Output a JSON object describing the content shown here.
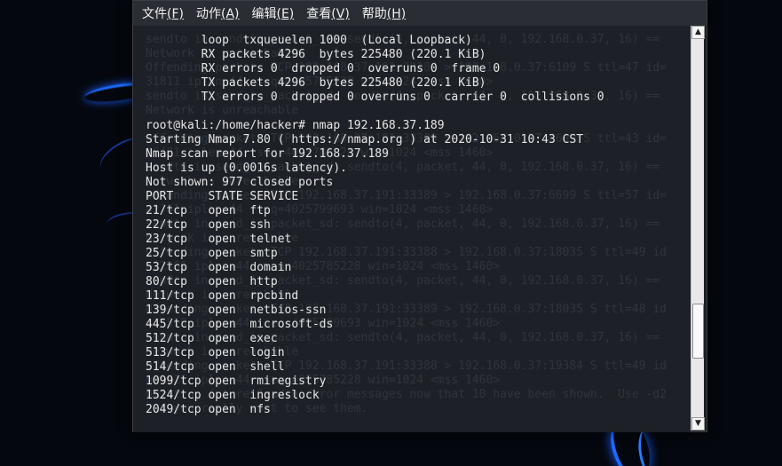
{
  "menu": {
    "items": [
      {
        "label": "文件",
        "accel": "(F)"
      },
      {
        "label": "动作",
        "accel": "(A)"
      },
      {
        "label": "编辑",
        "accel": "(E)"
      },
      {
        "label": "查看",
        "accel": "(V)"
      },
      {
        "label": "帮助",
        "accel": "(H)"
      }
    ]
  },
  "terminal": {
    "lines": [
      "        loop  txqueuelen 1000  (Local Loopback)",
      "        RX packets 4296  bytes 225480 (220.1 KiB)",
      "        RX errors 0  dropped 0  overruns 0  frame 0",
      "        TX packets 4296  bytes 225480 (220.1 KiB)",
      "        TX errors 0  dropped 0 overruns 0  carrier 0  collisions 0",
      "",
      "root@kali:/home/hacker# nmap 192.168.37.189",
      "Starting Nmap 7.80 ( https://nmap.org ) at 2020-10-31 10:43 CST",
      "Nmap scan report for 192.168.37.189",
      "Host is up (0.0016s latency).",
      "Not shown: 977 closed ports",
      "PORT     STATE SERVICE",
      "21/tcp   open  ftp",
      "22/tcp   open  ssh",
      "23/tcp   open  telnet",
      "25/tcp   open  smtp",
      "53/tcp   open  domain",
      "80/tcp   open  http",
      "111/tcp  open  rpcbind",
      "139/tcp  open  netbios-ssn",
      "445/tcp  open  microsoft-ds",
      "512/tcp  open  exec",
      "513/tcp  open  login",
      "514/tcp  open  shell",
      "1099/tcp open  rmiregistry",
      "1524/tcp open  ingreslock",
      "2049/tcp open  nfs"
    ],
    "ghost_lines": [
      "sendto in send_ip_packet_sd: sendto(4, packet, 44, 0, 192.168.0.37, 16) ==",
      "Network is unreachable",
      "Offending packet: TCP 192.168.37.191:33388 > 192.168.0.37:6109 S ttl=47 id=",
      "31811 iplen=44  seq=4025785228 win=1024 <mss 1460>",
      "sendto in send_ip_packet_sd: sendto(4, packet, 44, 0, 192.168.0.37, 16) ==",
      "Network is unreachable",
      "",
      "Offending packet: TCP 192.168.37.191:33389 > 192.168.0.37:6699 S ttl=43 id=",
      "26421 iplen=44  seq=4025785228 win=1024 <mss 1460>",
      "sendto in send_ip_packet_sd: sendto(4, packet, 44, 0, 192.168.0.37, 16) ==",
      "Network is unreachable",
      "Offending packet: TCP 192.168.37.191:33389 > 192.168.0.37:6699 S ttl=57 id=",
      "42761 iplen=44  seq=4025799693 win=1024 <mss 1460>",
      "sendto in send_ip_packet_sd: sendto(4, packet, 44, 0, 192.168.0.37, 16) ==",
      "Network is unreachable",
      "Offending packet: TCP 192.168.37.191:33388 > 192.168.0.37:18035 S ttl=49 id",
      "=22261 iplen=44  seq=4025785228 win=1024 <mss 1460>",
      "sendto in send_ip_packet_sd: sendto(4, packet, 44, 0, 192.168.0.37, 16) ==",
      "Network is unreachable",
      "Offending packet: TCP 192.168.37.191:33389 > 192.168.0.37:18035 S ttl=48 id",
      "=13519 iplen=44  seq=4025799693 win=1024 <mss 1460>",
      "sendto in send_ip_packet_sd: sendto(4, packet, 44, 0, 192.168.0.37, 16) ==",
      "Network is unreachable",
      "Offending packet: TCP 192.168.37.191:33388 > 192.168.0.37:19384 S ttl=49 id",
      "=31811 iplen=44  seq=4025785228 win=1024 <mss 1460>",
      "Omitting future Sendto error messages now that 10 have been shown.  Use -d2",
      " if you really want to see them."
    ]
  },
  "scrollbar": {
    "up_glyph": "▲",
    "down_glyph": "▼",
    "position_fraction": 0.82
  },
  "colors": {
    "terminal_bg": "#1d2127",
    "terminal_fg": "#e6e6e6",
    "menubar_bg": "#2a2e34",
    "accent_blue": "#1a6cff"
  }
}
